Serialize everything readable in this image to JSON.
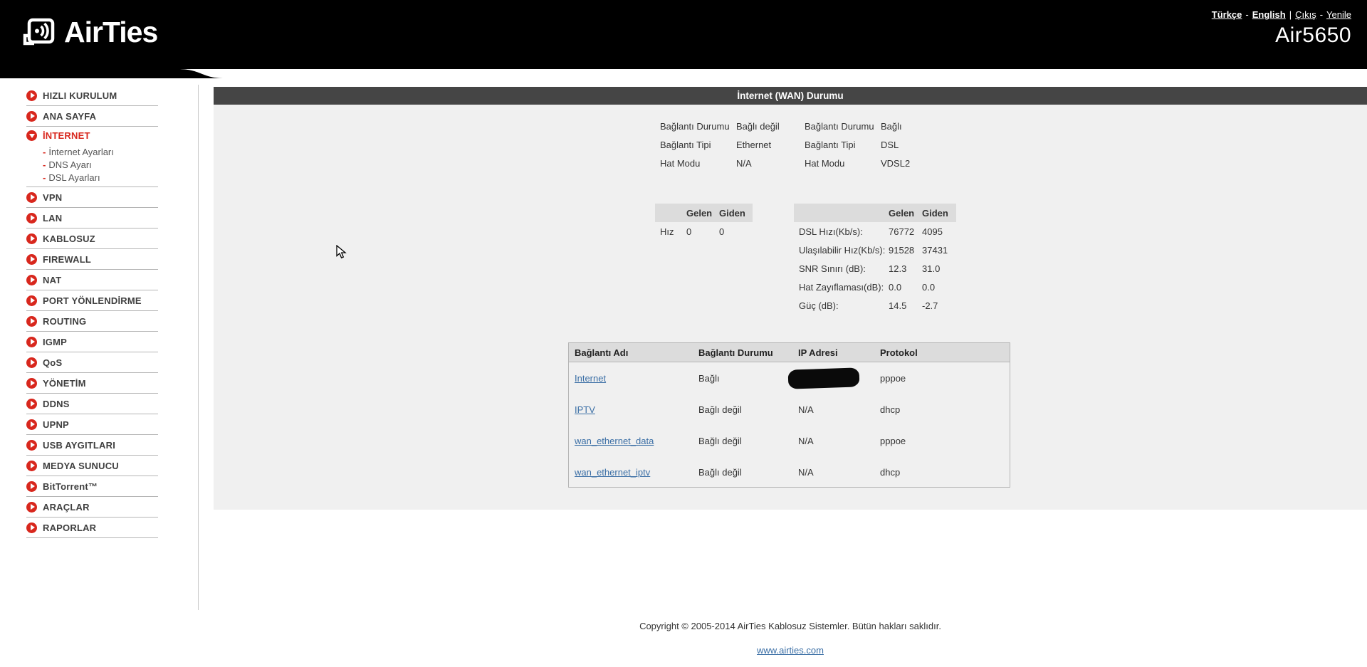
{
  "header": {
    "brand": "AirTies",
    "model": "Air5650",
    "lang_turkce": "Türkçe",
    "lang_english": "English",
    "link_cikis": "Çıkış",
    "link_yenile": "Yenile",
    "sep_dash1": "-",
    "sep_pipe": "|",
    "sep_dash2": "-"
  },
  "sidebar": {
    "items": [
      {
        "label": "HIZLI KURULUM"
      },
      {
        "label": "ANA SAYFA"
      },
      {
        "label": "İNTERNET"
      },
      {
        "label": "VPN"
      },
      {
        "label": "LAN"
      },
      {
        "label": "KABLOSUZ"
      },
      {
        "label": "FIREWALL"
      },
      {
        "label": "NAT"
      },
      {
        "label": "PORT YÖNLENDİRME"
      },
      {
        "label": "ROUTING"
      },
      {
        "label": "IGMP"
      },
      {
        "label": "QoS"
      },
      {
        "label": "YÖNETİM"
      },
      {
        "label": "DDNS"
      },
      {
        "label": "UPNP"
      },
      {
        "label": "USB AYGITLARI"
      },
      {
        "label": "MEDYA SUNUCU"
      },
      {
        "label": "BitTorrent™"
      },
      {
        "label": "ARAÇLAR"
      },
      {
        "label": "RAPORLAR"
      }
    ],
    "sub_items": [
      {
        "dash": "-",
        "label": "İnternet Ayarları"
      },
      {
        "dash": "-",
        "label": "DNS Ayarı"
      },
      {
        "dash": "-",
        "label": "DSL Ayarları"
      }
    ]
  },
  "main": {
    "title": "İnternet (WAN) Durumu",
    "status_left": {
      "rows": [
        {
          "label": "Bağlantı Durumu",
          "value": "Bağlı değil"
        },
        {
          "label": "Bağlantı Tipi",
          "value": "Ethernet"
        },
        {
          "label": "Hat Modu",
          "value": "N/A"
        }
      ]
    },
    "status_right": {
      "rows": [
        {
          "label": "Bağlantı Durumu",
          "value": "Bağlı"
        },
        {
          "label": "Bağlantı Tipi",
          "value": "DSL"
        },
        {
          "label": "Hat Modu",
          "value": "VDSL2"
        }
      ]
    },
    "traffic_table": {
      "col_gelen": "Gelen",
      "col_giden": "Giden",
      "row_label": "Hız",
      "gelen": "0",
      "giden": "0"
    },
    "dsl_table": {
      "col_gelen": "Gelen",
      "col_giden": "Giden",
      "rows": [
        {
          "label": "DSL Hızı(Kb/s):",
          "gelen": "76772",
          "giden": "4095"
        },
        {
          "label": "Ulaşılabilir Hız(Kb/s):",
          "gelen": "91528",
          "giden": "37431"
        },
        {
          "label": "SNR Sınırı (dB):",
          "gelen": "12.3",
          "giden": "31.0"
        },
        {
          "label": "Hat Zayıflaması(dB):",
          "gelen": "0.0",
          "giden": "0.0"
        },
        {
          "label": "Güç (dB):",
          "gelen": "14.5",
          "giden": "-2.7"
        }
      ]
    },
    "connections": {
      "headers": {
        "name": "Bağlantı Adı",
        "status": "Bağlantı Durumu",
        "ip": "IP Adresi",
        "protocol": "Protokol"
      },
      "rows": [
        {
          "name": "Internet",
          "status": "Bağlı",
          "ip": "",
          "protocol": "pppoe"
        },
        {
          "name": "IPTV",
          "status": "Bağlı değil",
          "ip": "N/A",
          "protocol": "dhcp"
        },
        {
          "name": "wan_ethernet_data",
          "status": "Bağlı değil",
          "ip": "N/A",
          "protocol": "pppoe"
        },
        {
          "name": "wan_ethernet_iptv",
          "status": "Bağlı değil",
          "ip": "N/A",
          "protocol": "dhcp"
        }
      ]
    }
  },
  "footer": {
    "copyright": "Copyright © 2005-2014 AirTies Kablosuz Sistemler. Bütün hakları saklıdır.",
    "link": "www.airties.com"
  },
  "colors": {
    "accent_red": "#d8271d",
    "link_blue": "#3a6ea5",
    "titlebar": "#454545",
    "content_bg": "#f0f0f0",
    "table_header_bg": "#dcdcdc"
  }
}
